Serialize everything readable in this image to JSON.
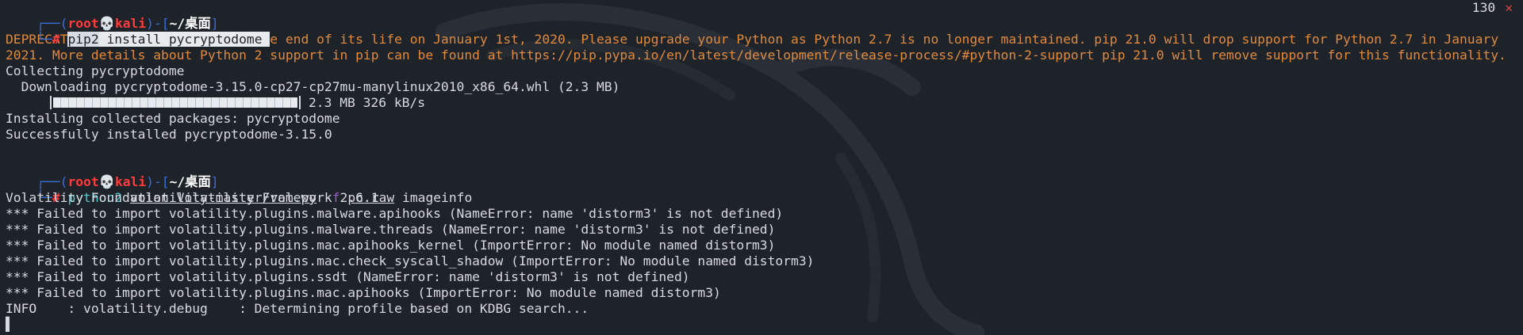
{
  "prompt": {
    "bracket_open": "┌──(",
    "user": "root",
    "skull": "💀",
    "host": "kali",
    "sep": ")-[",
    "cwd": "~/桌面",
    "bracket_close": "]",
    "second_line": "└─",
    "hash": "#"
  },
  "cmd1": {
    "program": "pip2",
    "args": " install pycryptodome"
  },
  "exit_status": {
    "code": "130",
    "mark": "✕"
  },
  "deprecation": "DEPRECATION: Python 2.7 reached the end of its life on January 1st, 2020. Please upgrade your Python as Python 2.7 is no longer maintained. pip 21.0 will drop support for Python 2.7 in January 2021. More details about Python 2 support in pip can be found at https://pip.pypa.io/en/latest/development/release-process/#python-2-support pip 21.0 will remove support for this functionality.",
  "pip_output": {
    "collecting": "Collecting pycryptodome",
    "downloading": "  Downloading pycryptodome-3.15.0-cp27-cp27mu-manylinux2010_x86_64.whl (2.3 MB)",
    "progress": 1.0,
    "progress_text": "2.3 MB 326 kB/s",
    "installing": "Installing collected packages: pycryptodome",
    "success": "Successfully installed pycryptodome-3.15.0"
  },
  "cmd2": {
    "program": "python2",
    "script": "volatility-master/vol.py",
    "flag": "-f",
    "file": "pc.raw",
    "plugin": "imageinfo"
  },
  "vol_output": [
    "Volatility Foundation Volatility Framework 2.6.1",
    "*** Failed to import volatility.plugins.malware.apihooks (NameError: name 'distorm3' is not defined)",
    "*** Failed to import volatility.plugins.malware.threads (NameError: name 'distorm3' is not defined)",
    "*** Failed to import volatility.plugins.mac.apihooks_kernel (ImportError: No module named distorm3)",
    "*** Failed to import volatility.plugins.mac.check_syscall_shadow (ImportError: No module named distorm3)",
    "*** Failed to import volatility.plugins.ssdt (NameError: name 'distorm3' is not defined)",
    "*** Failed to import volatility.plugins.mac.apihooks (ImportError: No module named distorm3)",
    "INFO    : volatility.debug    : Determining profile based on KDBG search..."
  ],
  "colors": {
    "background": "#1e2229",
    "prompt_blue": "#3a6fd8",
    "prompt_red": "#ff3b3b",
    "command_cyan": "#4ec9d0",
    "warning_orange": "#e08a3c",
    "flag_purple": "#9b5cc6"
  }
}
